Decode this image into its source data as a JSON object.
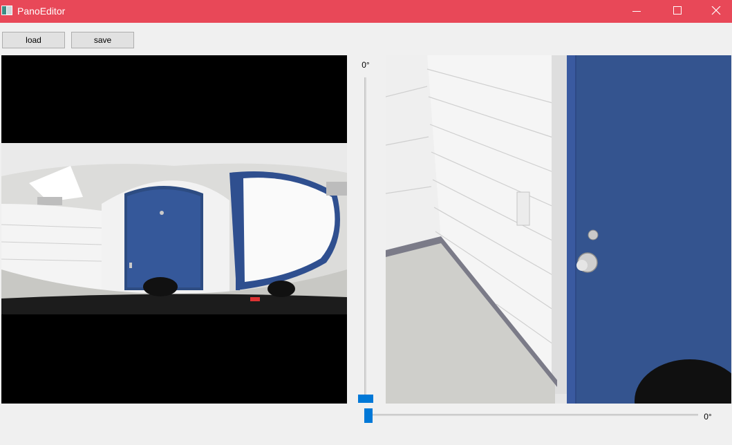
{
  "window": {
    "title": "PanoEditor",
    "accent": "#e84858",
    "controls": [
      "minimize-icon",
      "maximize-icon",
      "close-icon"
    ]
  },
  "toolbar": {
    "load_label": "load",
    "save_label": "save"
  },
  "views": {
    "panorama_icon": "equirectangular-panorama-image",
    "perspective_icon": "perspective-view-image"
  },
  "sliders": {
    "vertical": {
      "label": "0°",
      "value_degrees": 0,
      "color": "#0078d7"
    },
    "horizontal": {
      "label": "0°",
      "value_degrees": 0,
      "color": "#0078d7"
    }
  }
}
